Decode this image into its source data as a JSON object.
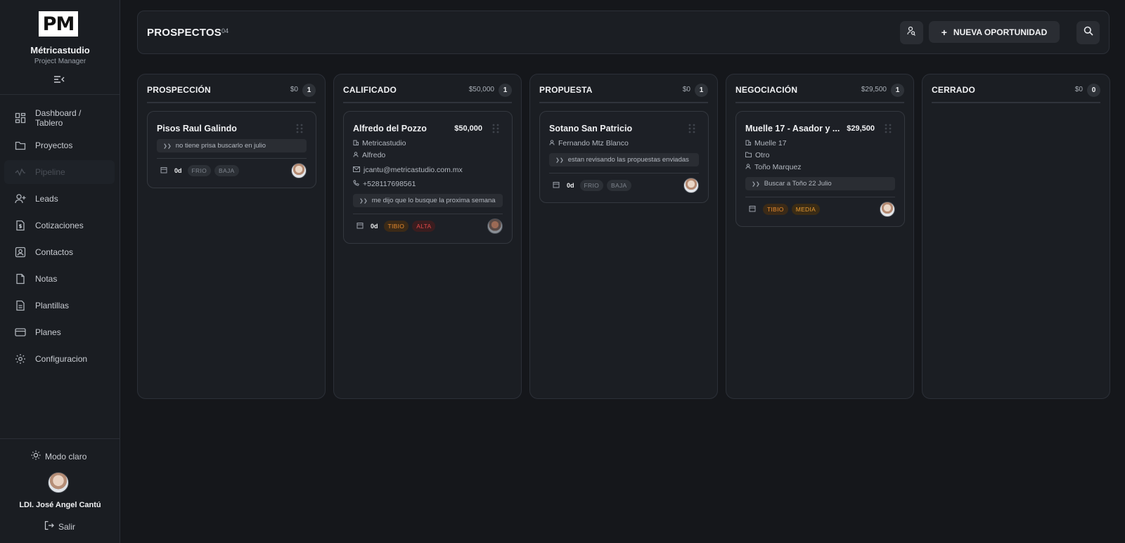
{
  "app": {
    "logo_text": "PM",
    "name": "Métricastudio",
    "subtitle": "Project Manager"
  },
  "sidebar": {
    "items": [
      {
        "label": "Dashboard / Tablero",
        "icon": "dashboard-icon"
      },
      {
        "label": "Proyectos",
        "icon": "folder-icon"
      },
      {
        "label": "Pipeline",
        "icon": "pipeline-icon",
        "active": true
      },
      {
        "label": "Leads",
        "icon": "user-plus-icon"
      },
      {
        "label": "Cotizaciones",
        "icon": "file-dollar-icon"
      },
      {
        "label": "Contactos",
        "icon": "contact-card-icon"
      },
      {
        "label": "Notas",
        "icon": "file-icon"
      },
      {
        "label": "Plantillas",
        "icon": "file-text-icon"
      },
      {
        "label": "Planes",
        "icon": "credit-card-icon"
      },
      {
        "label": "Configuracion",
        "icon": "gear-icon"
      }
    ],
    "mode_toggle": "Modo claro",
    "user_name": "LDI. José Angel Cantú",
    "logout": "Salir"
  },
  "header": {
    "title": "PROSPECTOS",
    "count": "04",
    "new_button": "NUEVA OPORTUNIDAD"
  },
  "columns": [
    {
      "title": "PROSPECCIÓN",
      "amount": "$0",
      "count": "1",
      "card": {
        "title": "Pisos Raul Galindo",
        "note": "no tiene prisa buscarlo en julio",
        "days": "0d",
        "badges": [
          "FRIO",
          "BAJA"
        ]
      }
    },
    {
      "title": "CALIFICADO",
      "amount": "$50,000",
      "count": "1",
      "card": {
        "title": "Alfredo del Pozzo",
        "amount": "$50,000",
        "company": "Metricastudio",
        "contact": "Alfredo",
        "email": "jcantu@metricastudio.com.mx",
        "phone": "+528117698561",
        "note": "me dijo que lo busque la proxima semana",
        "days": "0d",
        "badges": [
          "TIBIO",
          "ALTA"
        ]
      }
    },
    {
      "title": "PROPUESTA",
      "amount": "$0",
      "count": "1",
      "card": {
        "title": "Sotano San Patricio",
        "contact": "Fernando Mtz Blanco",
        "note": "estan revisando las propuestas enviadas",
        "days": "0d",
        "badges": [
          "FRIO",
          "BAJA"
        ]
      }
    },
    {
      "title": "NEGOCIACIÓN",
      "amount": "$29,500",
      "count": "1",
      "card": {
        "title": "Muelle 17 - Asador y ...",
        "amount": "$29,500",
        "company": "Muelle 17",
        "category": "Otro",
        "contact": "Toño Marquez",
        "note": "Buscar a Toño 22 Julio",
        "badges": [
          "TIBIO",
          "MEDIA"
        ]
      }
    },
    {
      "title": "CERRADO",
      "amount": "$0",
      "count": "0"
    }
  ],
  "colors": {
    "background": "#15171b",
    "panel": "#1b1e23",
    "badge_orange": "#e88b2e",
    "badge_red": "#e04848",
    "badge_grey": "#7f858e"
  }
}
